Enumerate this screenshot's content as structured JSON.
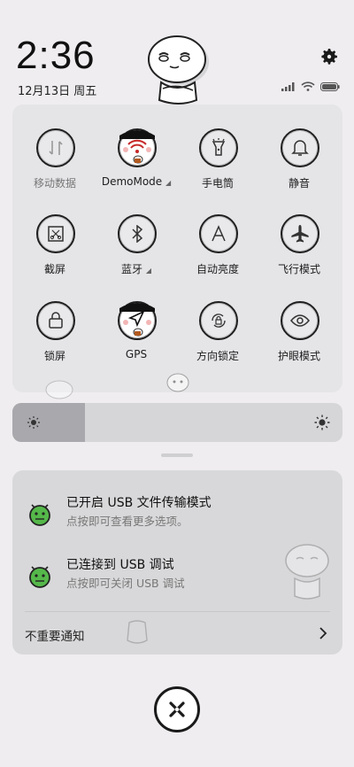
{
  "status": {
    "time": "2:36",
    "date": "12月13日 周五"
  },
  "tiles": [
    {
      "label": "移动数据",
      "icon": "mobile-data-icon"
    },
    {
      "label": "DemoMode",
      "icon": "wifi-icon"
    },
    {
      "label": "手电筒",
      "icon": "flashlight-icon"
    },
    {
      "label": "静音",
      "icon": "bell-icon"
    },
    {
      "label": "截屏",
      "icon": "screenshot-icon"
    },
    {
      "label": "蓝牙",
      "icon": "bluetooth-icon"
    },
    {
      "label": "自动亮度",
      "icon": "auto-brightness-icon"
    },
    {
      "label": "飞行模式",
      "icon": "airplane-icon"
    },
    {
      "label": "锁屏",
      "icon": "lock-icon"
    },
    {
      "label": "GPS",
      "icon": "location-arrow-icon"
    },
    {
      "label": "方向锁定",
      "icon": "rotation-lock-icon"
    },
    {
      "label": "护眼模式",
      "icon": "eye-icon"
    }
  ],
  "brightness": {
    "level": 0.22
  },
  "notifications": [
    {
      "title": "已开启 USB 文件传输模式",
      "subtitle": "点按即可查看更多选项。"
    },
    {
      "title": "已连接到 USB 调试",
      "subtitle": "点按即可关闭 USB 调试"
    }
  ],
  "unimportant_label": "不重要通知",
  "colors": {
    "background": "#efedf0",
    "panel": "#e5e4e7",
    "notification_card": "#d8d8da",
    "android_green": "#55b84a"
  }
}
